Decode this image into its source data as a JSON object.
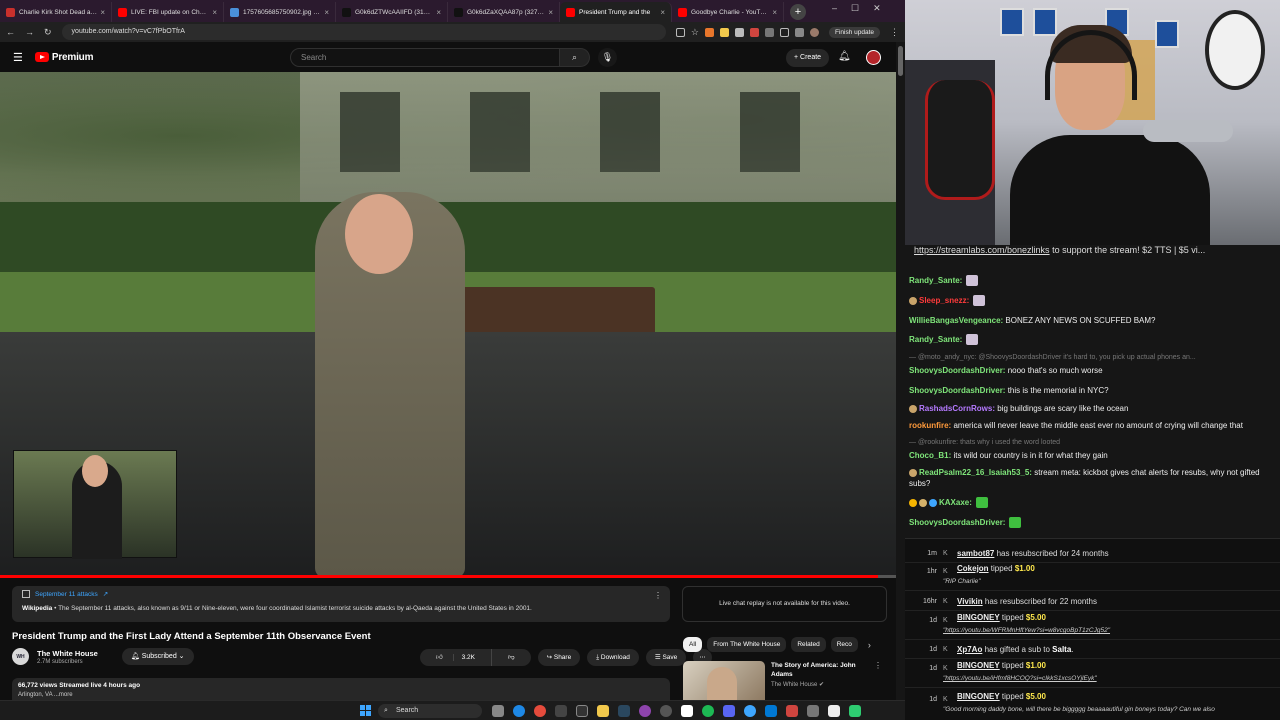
{
  "browser": {
    "tabs": [
      {
        "title": "Charlie Kirk Shot Dead at 31",
        "color": "#c9302c",
        "active": false
      },
      {
        "title": "LIVE: FBI update on Charlie",
        "color": "#ff0000",
        "active": false
      },
      {
        "title": "1757605685750902.jpg (1200",
        "color": "#4a90d9",
        "active": false
      },
      {
        "title": "G0k6dZTWcAAIIFD (312×56",
        "color": "#111111",
        "active": false
      },
      {
        "title": "G0k6dZaXQAA87p (327×48",
        "color": "#111111",
        "active": false
      },
      {
        "title": "President Trump and the",
        "color": "#ff0000",
        "active": true
      },
      {
        "title": "Goodbye Charlie - YouTube",
        "color": "#ff0000",
        "active": false
      }
    ],
    "url": "youtube.com/watch?v=vC7fPbOTfrA",
    "finish_update": "Finish update"
  },
  "youtube": {
    "logo_text": "Premium",
    "search_placeholder": "Search",
    "create_label": "Create",
    "info": {
      "topic": "September 11 attacks",
      "source": "Wikipedia",
      "text": " • The September 11 attacks, also known as 9/11 or Nine-eleven, were four coordinated Islamist terrorist suicide attacks by al-Qaeda against the United States in 2001."
    },
    "video_title": "President Trump and the First Lady Attend a September 11th Observance Event",
    "channel": {
      "name": "The White House",
      "subs": "2.7M subscribers",
      "subscribed_label": "Subscribed"
    },
    "actions": {
      "likes": "3.2K",
      "share": "Share",
      "download": "Download",
      "save": "Save"
    },
    "description": {
      "views": "66,772 views  Streamed live 4 hours ago",
      "location": "Arlington, VA  ...more"
    },
    "live_chat_note": "Live chat replay is not available for this video.",
    "chips": [
      "All",
      "From The White House",
      "Related",
      "Reco"
    ],
    "recommendation": {
      "title": "The Story of America: John Adams",
      "channel": "The White House"
    },
    "progress": 0.98
  },
  "taskbar": {
    "search": "Search"
  },
  "stream": {
    "pinned_link": "https://streamlabs.com/bonezlinks",
    "pinned_rest": " to support the stream! $2 TTS | $5 vi...",
    "chat": [
      {
        "user": "Randy_Sante:",
        "color": "#7fe57a",
        "text": "",
        "emote": true
      },
      {
        "user": "Sleep_snezz:",
        "color": "#ff3b3b",
        "text": "",
        "emote": true,
        "badge": true
      },
      {
        "user": "WillieBangasVengeance:",
        "color": "#7fe57a",
        "text": " BONEZ ANY NEWS ON SCUFFED BAM?"
      },
      {
        "user": "Randy_Sante:",
        "color": "#7fe57a",
        "text": "",
        "emote": true
      },
      {
        "reply": "— @moto_andy_nyc: @ShoovysDoordashDriver it's hard to, you pick up actual phones an..."
      },
      {
        "user": "ShoovysDoordashDriver:",
        "color": "#7fe57a",
        "text": " nooo  that's so much worse",
        "emote_mid": true
      },
      {
        "user": "ShoovysDoordashDriver:",
        "color": "#7fe57a",
        "text": " this is the memorial in NYC?"
      },
      {
        "user": "RashadsCornRows:",
        "color": "#b57aff",
        "text": " big buildings are scary like the ocean",
        "badge": true
      },
      {
        "user": "rookunfire:",
        "color": "#ff9a3b",
        "text": " america will never leave the middle east ever no amount of crying will change that"
      },
      {
        "reply": "— @rookunfire: thats why i used the word looted"
      },
      {
        "user": "Choco_B1:",
        "color": "#7fe57a",
        "text": " its wild our country is in it for what they gain"
      },
      {
        "user": "ReadPsalm22_16_Isaiah53_5:",
        "color": "#7fe57a",
        "text": " stream meta: kickbot gives chat alerts for resubs, why not gifted subs?",
        "badge": true,
        "wrap": true
      },
      {
        "user": "KAXaxe:",
        "color": "#7fe57a",
        "text": "",
        "emote": true,
        "multibadge": true
      },
      {
        "user": "ShoovysDoordashDriver:",
        "color": "#7fe57a",
        "text": "",
        "emote": true
      }
    ],
    "events": [
      {
        "time": "1m",
        "name": "sambot87",
        "action": " has resubscribed for 24 months",
        "amount": "",
        "message": ""
      },
      {
        "time": "1hr",
        "name": "Cokejon",
        "action": " tipped ",
        "amount": "$1.00",
        "message": "\"RIP Charlie\""
      },
      {
        "time": "16hr",
        "name": "Vivikin",
        "action": " has resubscribed for 22 months",
        "amount": "",
        "message": ""
      },
      {
        "time": "1d",
        "name": "BINGONEY",
        "action": " tipped ",
        "amount": "$5.00",
        "message": "\"https://youtu.be/WFRMnHftYew?si=w8vcgoBpT1zCJg52\"",
        "link": true
      },
      {
        "time": "1d",
        "name": "Xp7Ao",
        "action": " has gifted a sub to ",
        "amount": "",
        "target": "Salta",
        "message": ""
      },
      {
        "time": "1d",
        "name": "BINGONEY",
        "action": " tipped ",
        "amount": "$1.00",
        "message": "\"https://youtu.be/iHfmf8HCOQ?si=cIkkS1xcsOYjlEyk\"",
        "link": true
      },
      {
        "time": "1d",
        "name": "BINGONEY",
        "action": " tipped ",
        "amount": "$5.00",
        "message": "\"Good morning daddy bone, will there be biggggg beaaaautiful gin boneys today? Can we also"
      }
    ]
  }
}
